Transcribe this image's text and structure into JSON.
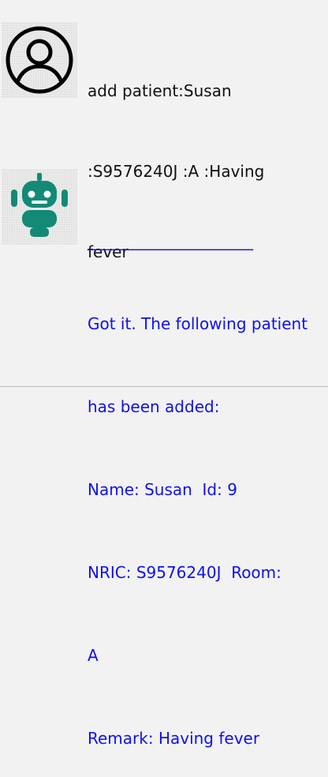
{
  "user_message": {
    "avatar_icon": "user-circle-icon",
    "lines": [
      "add patient:Susan",
      ":S9576240J :A :Having",
      "fever"
    ]
  },
  "bot_message": {
    "avatar_icon": "robot-icon",
    "accent_color": "#138a75",
    "text_color": "#1010ee",
    "lines": [
      "_____________________",
      "Got it. The following patient",
      "has been added:",
      "Name: Susan  Id: 9",
      "NRIC: S9576240J  Room:",
      "A",
      "Remark: Having fever"
    ]
  }
}
